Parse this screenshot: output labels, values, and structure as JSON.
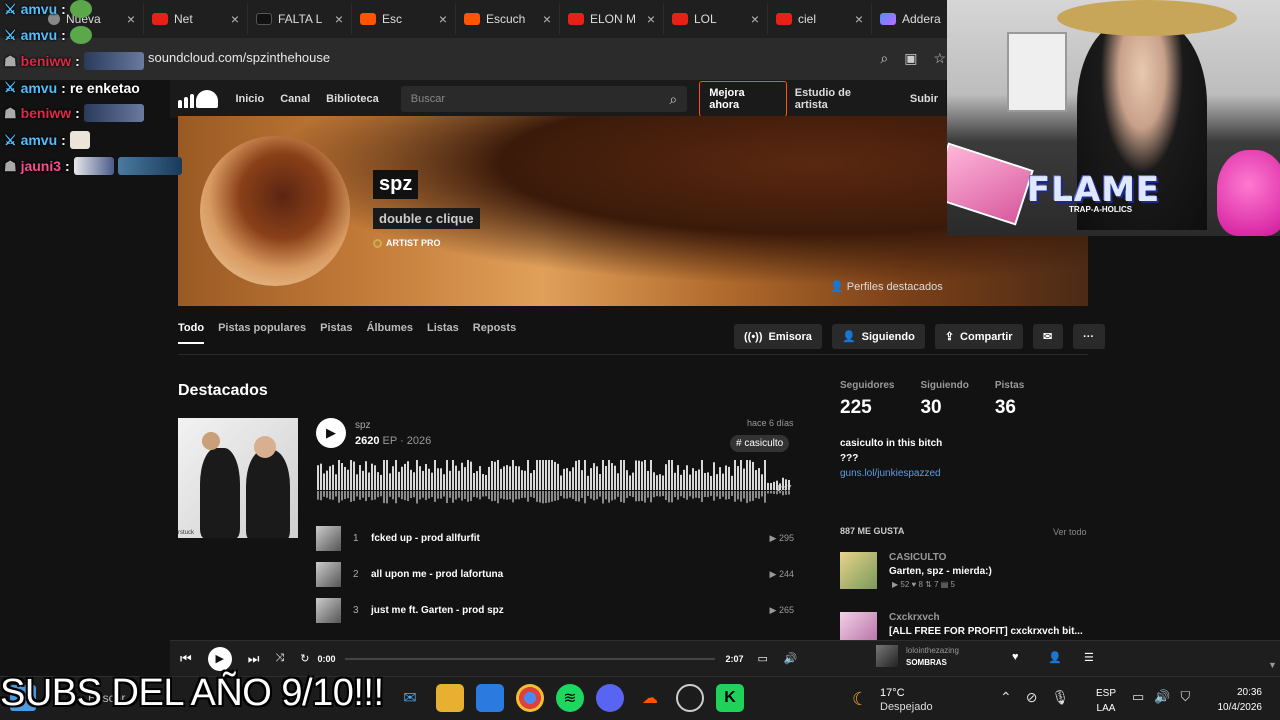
{
  "browser": {
    "tabs": [
      {
        "label": "Nueva",
        "icon": "chrome-icon"
      },
      {
        "label": "Net",
        "icon": "youtube-icon"
      },
      {
        "label": "FALTA L",
        "icon": "tiktok-icon"
      },
      {
        "label": "Esc",
        "icon": "soundcloud-icon"
      },
      {
        "label": "Escuch",
        "icon": "soundcloud-icon"
      },
      {
        "label": "ELON M",
        "icon": "youtube-icon"
      },
      {
        "label": "LOL",
        "icon": "youtube-icon"
      },
      {
        "label": "ciel",
        "icon": "youtube-icon"
      },
      {
        "label": "Addera",
        "icon": "gemini-icon"
      }
    ],
    "url": "soundcloud.com/spzinthehouse"
  },
  "sc_nav": {
    "items": [
      "Inicio",
      "Canal",
      "Biblioteca"
    ],
    "search_placeholder": "Buscar",
    "upgrade": "Mejora ahora",
    "studio": "Estudio de artista",
    "upload": "Subir"
  },
  "profile": {
    "name": "spz",
    "subtitle": "double c clique",
    "badge": "ARTIST PRO",
    "featured_profiles": "Perfiles destacados"
  },
  "tabs": [
    "Todo",
    "Pistas populares",
    "Pistas",
    "Álbumes",
    "Listas",
    "Reposts"
  ],
  "actions": {
    "station": "Emisora",
    "following": "Siguiendo",
    "share": "Compartir"
  },
  "featured": {
    "section_title": "Destacados",
    "artist": "spz",
    "title": "2620",
    "meta": "EP · 2026",
    "ago": "hace 6 días",
    "tag": "# casiculto",
    "duration": "1:47",
    "cover_caption": "rstuck",
    "tracks": [
      {
        "num": "1",
        "name": "fcked up - prod allfurfit",
        "plays": "295"
      },
      {
        "num": "2",
        "name": "all upon me - prod lafortuna",
        "plays": "244"
      },
      {
        "num": "3",
        "name": "just me ft. Garten - prod spz",
        "plays": "265"
      }
    ]
  },
  "stats": [
    {
      "label": "Seguidores",
      "value": "225"
    },
    {
      "label": "Siguiendo",
      "value": "30"
    },
    {
      "label": "Pistas",
      "value": "36"
    }
  ],
  "bio": {
    "line1": "casiculto in this bitch",
    "line2": "???",
    "link": "guns.lol/junkiespazzed"
  },
  "likes": {
    "header": "887 ME GUSTA",
    "see_all": "Ver todo",
    "items": [
      {
        "artist": "CASICULTO",
        "title": "Garten, spz - mierda:)",
        "meta": "▶ 52   ♥ 8   ⇅ 7   ▤ 5"
      },
      {
        "artist": "Cxckrxvch",
        "title": "[ALL FREE FOR PROFIT] cxckrxvch bit...",
        "meta": ""
      }
    ]
  },
  "player": {
    "elapsed": "0:00",
    "total": "2:07",
    "now_artist": "lolointhezazing",
    "now_title": "SOMBRAS"
  },
  "chat": [
    {
      "user": "amvu",
      "text": "",
      "color": "#4fc0ff"
    },
    {
      "user": "amvu",
      "text": "",
      "color": "#4fc0ff"
    },
    {
      "user": "beniww",
      "text": "",
      "color": "#e0294a"
    },
    {
      "user": "amvu",
      "text": "re enketao",
      "color": "#4fc0ff"
    },
    {
      "user": "beniww",
      "text": "",
      "color": "#e0294a"
    },
    {
      "user": "amvu",
      "text": "",
      "color": "#4fc0ff"
    },
    {
      "user": "jauni3",
      "text": "",
      "color": "#ff4a8e"
    }
  ],
  "webcam": {
    "logo_text": "FLAME",
    "logo_sub": "TRAP-A-HOLICS"
  },
  "taskbar": {
    "search_label": "Buscar",
    "weather_temp": "17°C",
    "weather_desc": "Despejado",
    "lang_top": "ESP",
    "lang_bottom": "LAA",
    "time": "20:36",
    "date": "10/4/2026"
  },
  "overlay_caption": "SUBS DEL AÑO 9/10!!!"
}
